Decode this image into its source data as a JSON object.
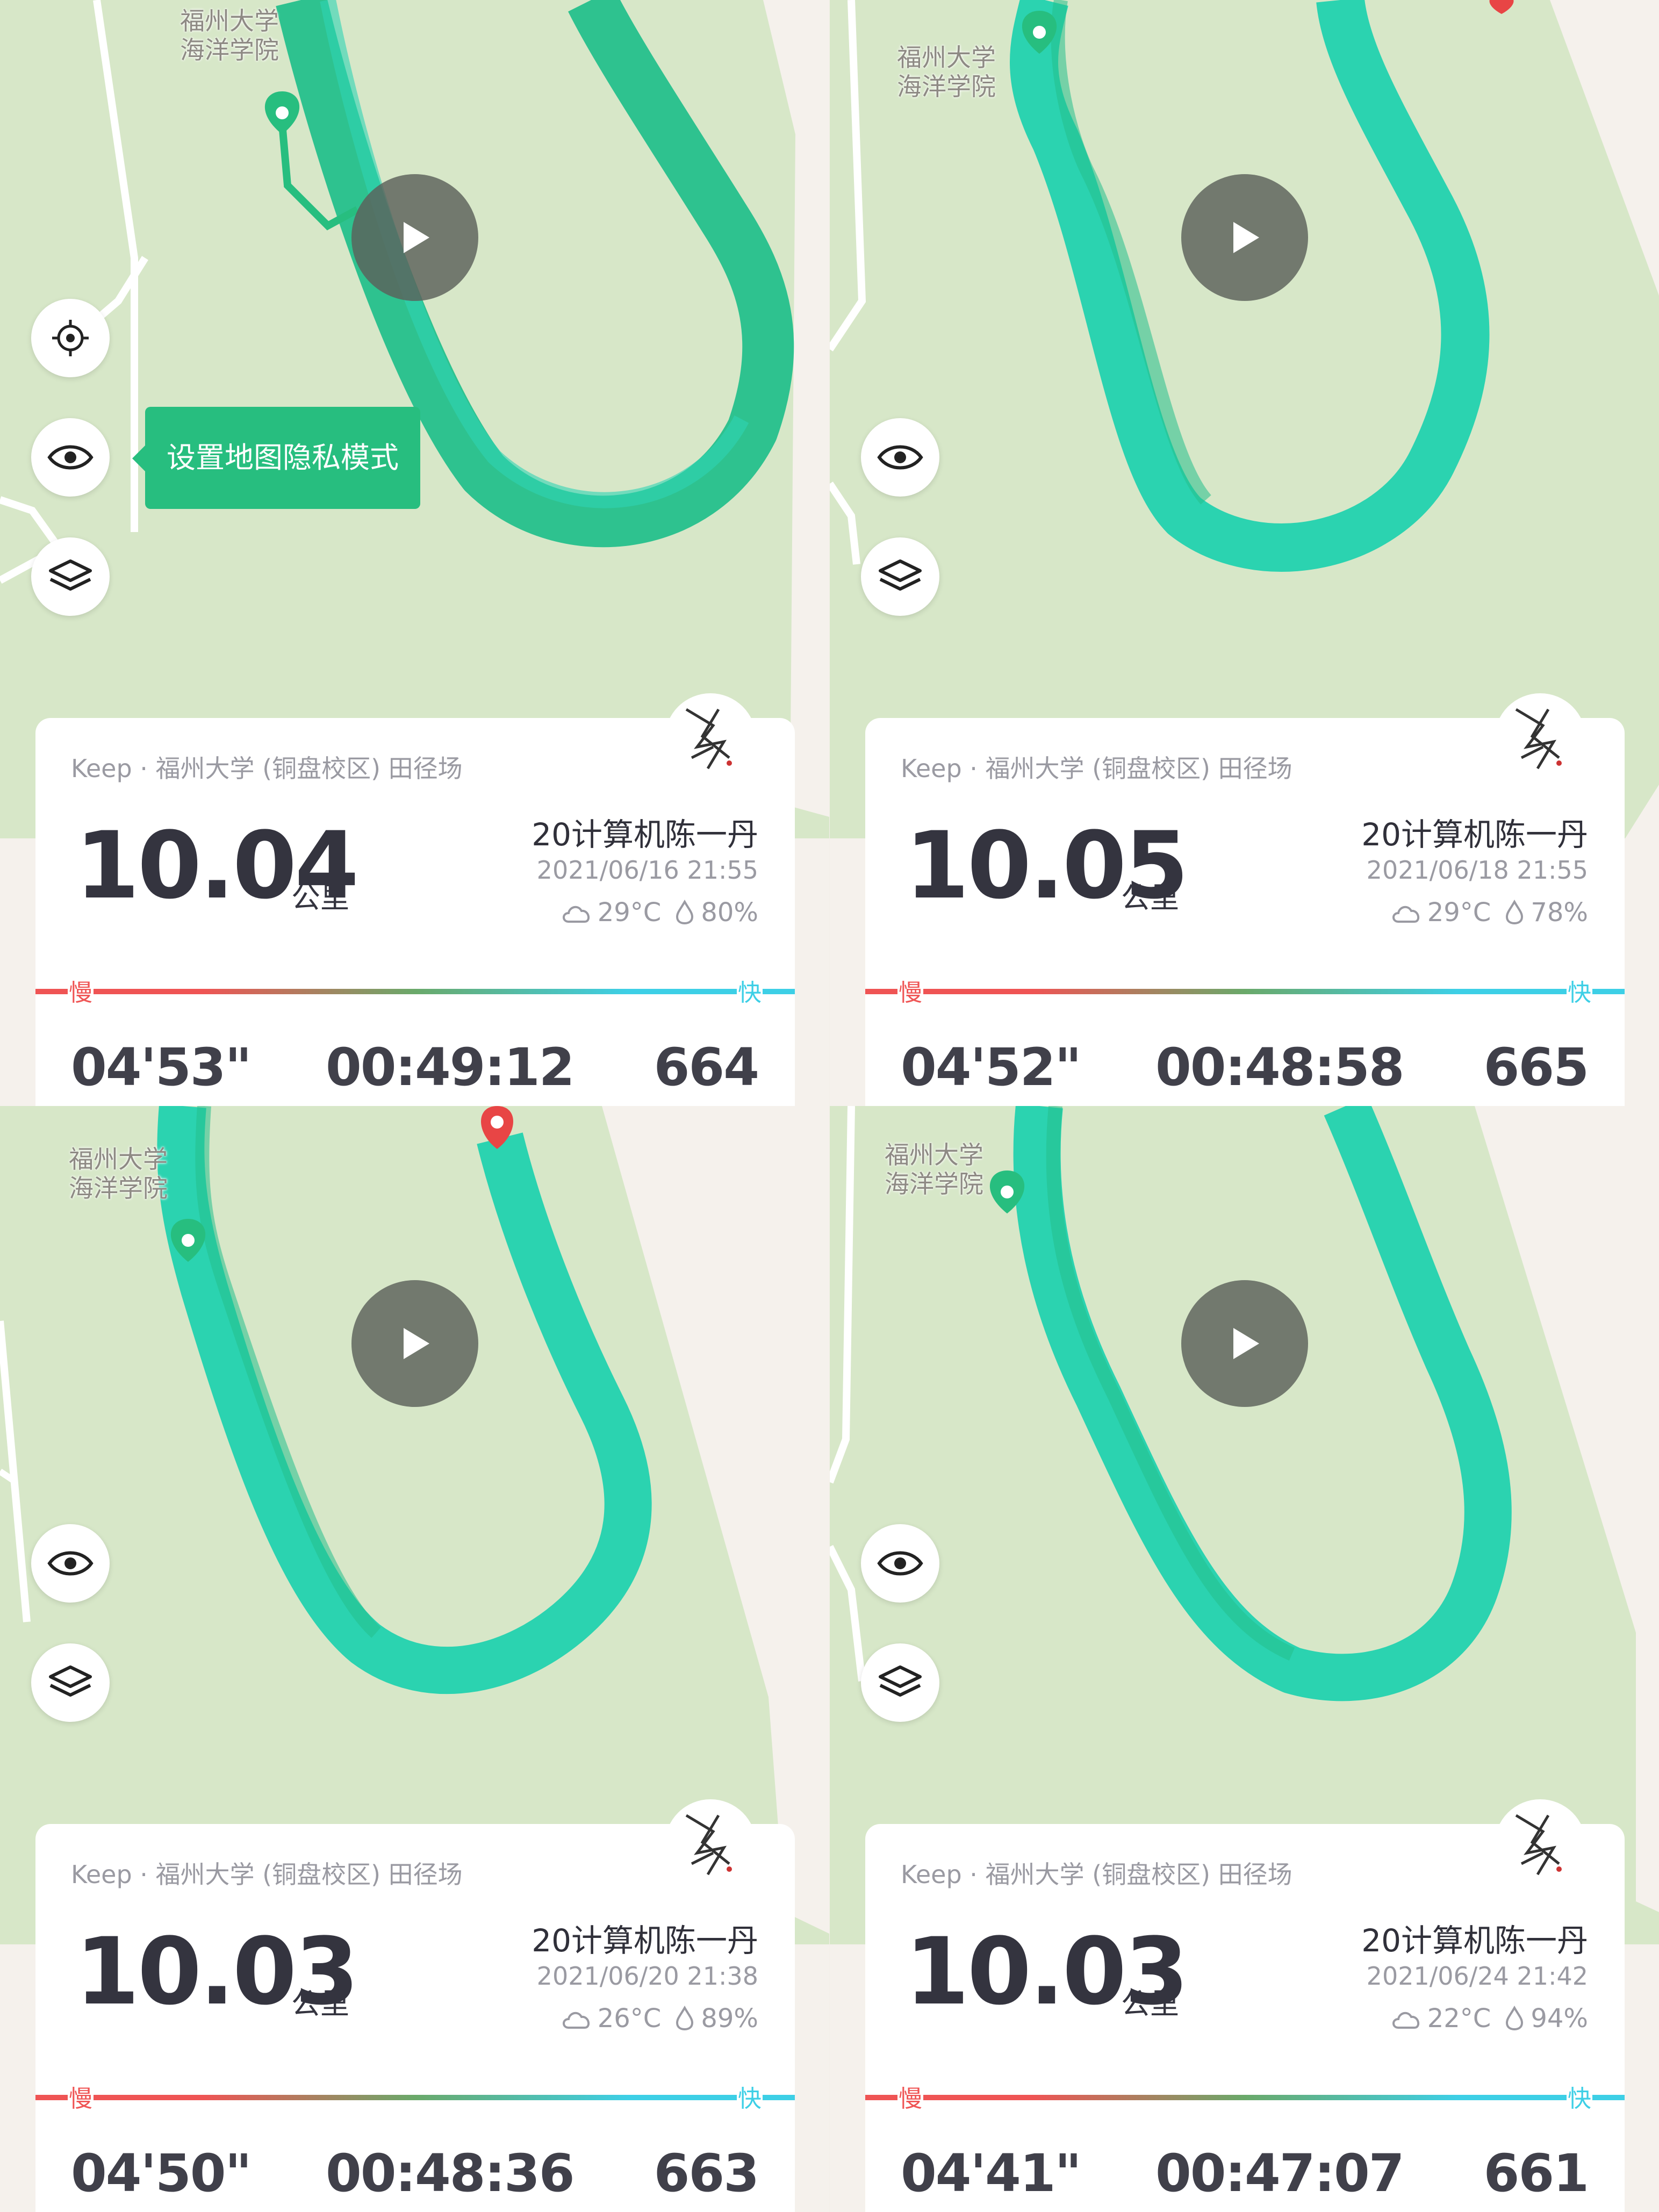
{
  "accent_color": "#27be7f",
  "route_color": "#2bd3b0",
  "tooltip": {
    "text": "设置地图隐私模式"
  },
  "cards": [
    {
      "map_label": "福州大学\n海洋学院",
      "source": "Keep · 福州大学 (铜盘校区) 田径场",
      "distance": "10.04",
      "unit": "公里",
      "user": "20计算机陈一丹",
      "datetime": "2021/06/16 21:55",
      "temperature": "29°C",
      "humidity": "80%",
      "slow_label": "慢",
      "fast_label": "快",
      "pace": "04'53\"",
      "duration": "00:49:12",
      "calories": "664"
    },
    {
      "map_label": "福州大学\n海洋学院",
      "source": "Keep · 福州大学 (铜盘校区) 田径场",
      "distance": "10.05",
      "unit": "公里",
      "user": "20计算机陈一丹",
      "datetime": "2021/06/18 21:55",
      "temperature": "29°C",
      "humidity": "78%",
      "slow_label": "慢",
      "fast_label": "快",
      "pace": "04'52\"",
      "duration": "00:48:58",
      "calories": "665"
    },
    {
      "map_label": "福州大学\n海洋学院",
      "source": "Keep · 福州大学 (铜盘校区) 田径场",
      "distance": "10.03",
      "unit": "公里",
      "user": "20计算机陈一丹",
      "datetime": "2021/06/20 21:38",
      "temperature": "26°C",
      "humidity": "89%",
      "slow_label": "慢",
      "fast_label": "快",
      "pace": "04'50\"",
      "duration": "00:48:36",
      "calories": "663"
    },
    {
      "map_label": "福州大学\n海洋学院",
      "source": "Keep · 福州大学 (铜盘校区) 田径场",
      "distance": "10.03",
      "unit": "公里",
      "user": "20计算机陈一丹",
      "datetime": "2021/06/24 21:42",
      "temperature": "22°C",
      "humidity": "94%",
      "slow_label": "慢",
      "fast_label": "快",
      "pace": "04'41\"",
      "duration": "00:47:07",
      "calories": "661"
    }
  ]
}
